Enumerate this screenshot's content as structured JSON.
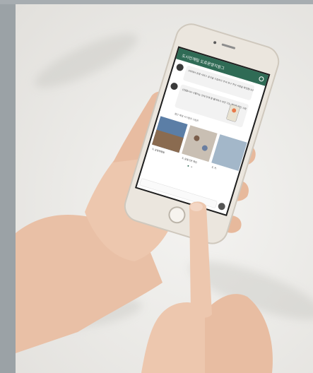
{
  "scene": "hand holding smartphone showing chat app",
  "colors": {
    "background": "#eceae6",
    "left_strip": "#9ba2a6",
    "phone_body": "#e9e4dc",
    "app_header": "#2f6b55",
    "screen": "#ffffff",
    "skin": "#edc7ae"
  },
  "phone": {
    "header_title": "도시인재팀 도로운영지원그",
    "message_1": "시작에서 운영 서비스 공식을 수집하고 주셔 보나 주신 사항을 확인합니다",
    "message_2": "신청합니다 시행가능 안내 단계 잘 물어보시 보안 기능 해당화 확인 사항",
    "message_3": "접근 해결 시스템의 그림은",
    "card_1_caption": "도 공동체행동",
    "card_2_caption": "도 공동기관 확인",
    "card_3_caption": "도 커"
  }
}
